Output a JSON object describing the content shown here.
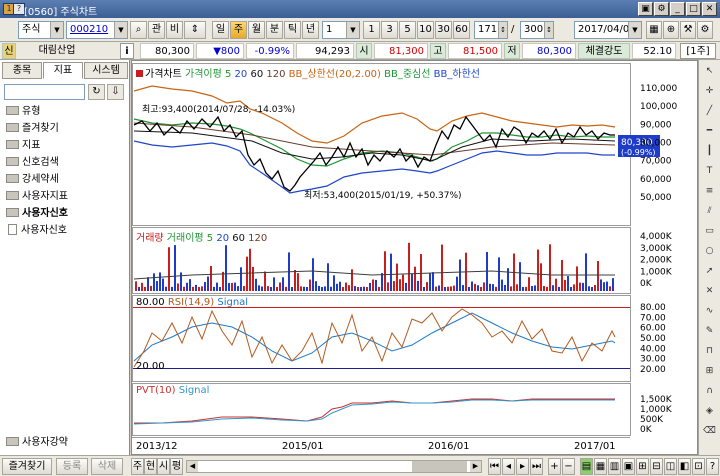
{
  "window": {
    "title": "[0560] 주식차트"
  },
  "toolbar": {
    "market": "주식",
    "code": "000210",
    "btn_gwan": "관",
    "btn_bi": "비",
    "periods": [
      "일",
      "주",
      "월",
      "분",
      "틱",
      "년"
    ],
    "period_value": "1",
    "intervals": [
      "1",
      "3",
      "5",
      "10",
      "30",
      "60"
    ],
    "count_a": "171",
    "count_sep": "/",
    "count_b": "300",
    "date": "2017/04/04"
  },
  "quote": {
    "tag": "신",
    "name": "대림산업",
    "info_icon": "i",
    "price": "80,300",
    "change": "▼800",
    "rate": "-0.99%",
    "volume": "94,293",
    "open_label": "시",
    "open": "81,300",
    "high_label": "고",
    "high": "81,500",
    "low_label": "저",
    "low": "80,300",
    "strength_label": "체결강도",
    "strength": "52.10",
    "unit": "[1주]"
  },
  "left": {
    "tabs": [
      "종목",
      "지표",
      "시스템"
    ],
    "tree": [
      "유형",
      "즐겨찾기",
      "지표",
      "신호검색",
      "강세약세",
      "사용자지표",
      "사용자신호"
    ],
    "subitem": "사용자신호",
    "bottom_item": "사용자강약"
  },
  "chart": {
    "panel1_legend": [
      "가격차트",
      "가격이평 5",
      "20",
      "60",
      "120",
      "BB_상한선(20,2.00)",
      "BB_중심선",
      "BB_하한선"
    ],
    "panel1_y": [
      "110,000",
      "100,000",
      "90,000",
      "80,000",
      "70,000",
      "60,000",
      "50,000"
    ],
    "current_price": "80,300",
    "current_rate": "(-0.99%)",
    "annot_high": "최고:93,400(2014/07/28, -14.03%)",
    "annot_low": "최저:53,400(2015/01/19, +50.37%)",
    "panel2_legend": [
      "거래량",
      "거래이평 5",
      "20",
      "60",
      "120"
    ],
    "panel2_y": [
      "4,000K",
      "3,000K",
      "2,000K",
      "1,000K",
      "0K"
    ],
    "panel3_legend": [
      "80.00",
      "RSI(14,9)",
      "Signal"
    ],
    "panel3_y": [
      "80.00",
      "70.00",
      "60.00",
      "50.00",
      "40.00",
      "30.00",
      "20.00"
    ],
    "panel3_marker": "20.00",
    "panel4_legend": [
      "PVT(10)",
      "Signal"
    ],
    "panel4_y": [
      "1,500K",
      "1,000K",
      "500K",
      "0K"
    ],
    "x_labels": [
      "2013/12",
      "2015/01",
      "2016/01",
      "2017/01"
    ]
  },
  "bottom": {
    "favorites": "즐겨찾기",
    "register": "등록",
    "delete": "삭제",
    "tabs": [
      "주",
      "현",
      "시",
      "평"
    ]
  }
}
